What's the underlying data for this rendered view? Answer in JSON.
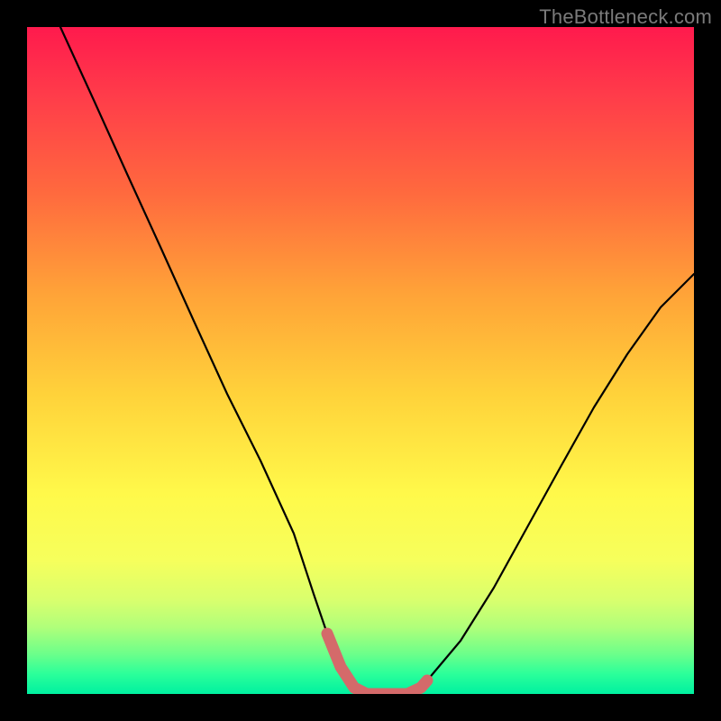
{
  "watermark": "TheBottleneck.com",
  "chart_data": {
    "type": "line",
    "title": "",
    "xlabel": "",
    "ylabel": "",
    "xlim": [
      0,
      100
    ],
    "ylim": [
      0,
      100
    ],
    "series": [
      {
        "name": "curve",
        "x": [
          5,
          10,
          15,
          20,
          25,
          30,
          35,
          40,
          43,
          45,
          47,
          49,
          51,
          53,
          55,
          57,
          60,
          65,
          70,
          75,
          80,
          85,
          90,
          95,
          100
        ],
        "values": [
          100,
          89,
          78,
          67,
          56,
          45,
          35,
          24,
          15,
          9,
          4,
          1,
          0,
          0,
          0,
          0,
          2,
          8,
          16,
          25,
          34,
          43,
          51,
          58,
          63
        ]
      },
      {
        "name": "highlight-band",
        "style": "thick",
        "color": "#d46a6a",
        "x": [
          45,
          47,
          49,
          51,
          53,
          55,
          57,
          59,
          60
        ],
        "values": [
          9,
          4,
          1,
          0,
          0,
          0,
          0,
          1,
          2
        ]
      }
    ],
    "background_gradient": {
      "top": "#ff1a4d",
      "mid": "#fff94a",
      "bottom": "#00f0a0"
    }
  }
}
